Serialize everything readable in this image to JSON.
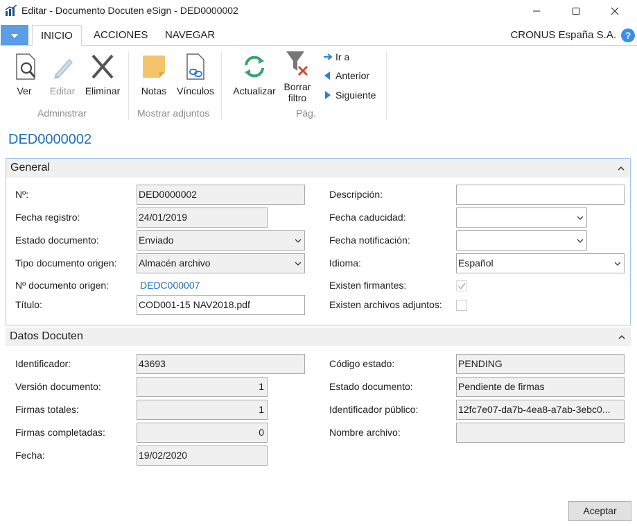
{
  "window": {
    "title": "Editar - Documento Docuten eSign - DED0000002"
  },
  "ribbon_tabs": [
    "INICIO",
    "ACCIONES",
    "NAVEGAR"
  ],
  "company": "CRONUS España S.A.",
  "help": "?",
  "ribbon": {
    "ver": "Ver",
    "editar": "Editar",
    "eliminar": "Eliminar",
    "notas": "Notas",
    "vinculos": "Vínculos",
    "actualizar": "Actualizar",
    "borrar_filtro_1": "Borrar",
    "borrar_filtro_2": "filtro",
    "ir_a": "Ir a",
    "anterior": "Anterior",
    "siguiente": "Siguiente",
    "group_administrar": "Administrar",
    "group_mostrar": "Mostrar adjuntos",
    "group_pag": "Pág."
  },
  "page_title": "DED0000002",
  "general": {
    "title": "General",
    "no_label": "Nº:",
    "no_value": "DED0000002",
    "fecha_registro_label": "Fecha registro:",
    "fecha_registro_value": "24/01/2019",
    "estado_label": "Estado documento:",
    "estado_value": "Enviado",
    "tipo_origen_label": "Tipo documento origen:",
    "tipo_origen_value": "Almacén archivo",
    "no_origen_label": "Nº documento origen:",
    "no_origen_value": "DEDC000007",
    "titulo_label": "Título:",
    "titulo_value": "COD001-15 NAV2018.pdf",
    "descripcion_label": "Descripción:",
    "descripcion_value": "",
    "fecha_caducidad_label": "Fecha caducidad:",
    "fecha_caducidad_value": "",
    "fecha_notificacion_label": "Fecha notificación:",
    "fecha_notificacion_value": "",
    "idioma_label": "Idioma:",
    "idioma_value": "Español",
    "firmantes_label": "Existen firmantes:",
    "firmantes_checked": true,
    "adjuntos_label": "Existen archivos adjuntos:",
    "adjuntos_checked": false
  },
  "datos": {
    "title": "Datos Docuten",
    "identificador_label": "Identificador:",
    "identificador_value": "43693",
    "version_label": "Versión documento:",
    "version_value": "1",
    "firmas_totales_label": "Firmas totales:",
    "firmas_totales_value": "1",
    "firmas_completadas_label": "Firmas completadas:",
    "firmas_completadas_value": "0",
    "fecha_label": "Fecha:",
    "fecha_value": "19/02/2020",
    "codigo_estado_label": "Código estado:",
    "codigo_estado_value": "PENDING",
    "estado_documento_label": "Estado documento:",
    "estado_documento_value": "Pendiente de firmas",
    "id_publico_label": "Identificador público:",
    "id_publico_value": "12fc7e07-da7b-4ea8-a7ab-3ebc0...",
    "nombre_archivo_label": "Nombre archivo:",
    "nombre_archivo_value": ""
  },
  "accept_button": "Aceptar",
  "colors": {
    "link": "#1f6fb4",
    "app_menu": "#5c9ee6",
    "section_border": "#9fc3eb"
  }
}
